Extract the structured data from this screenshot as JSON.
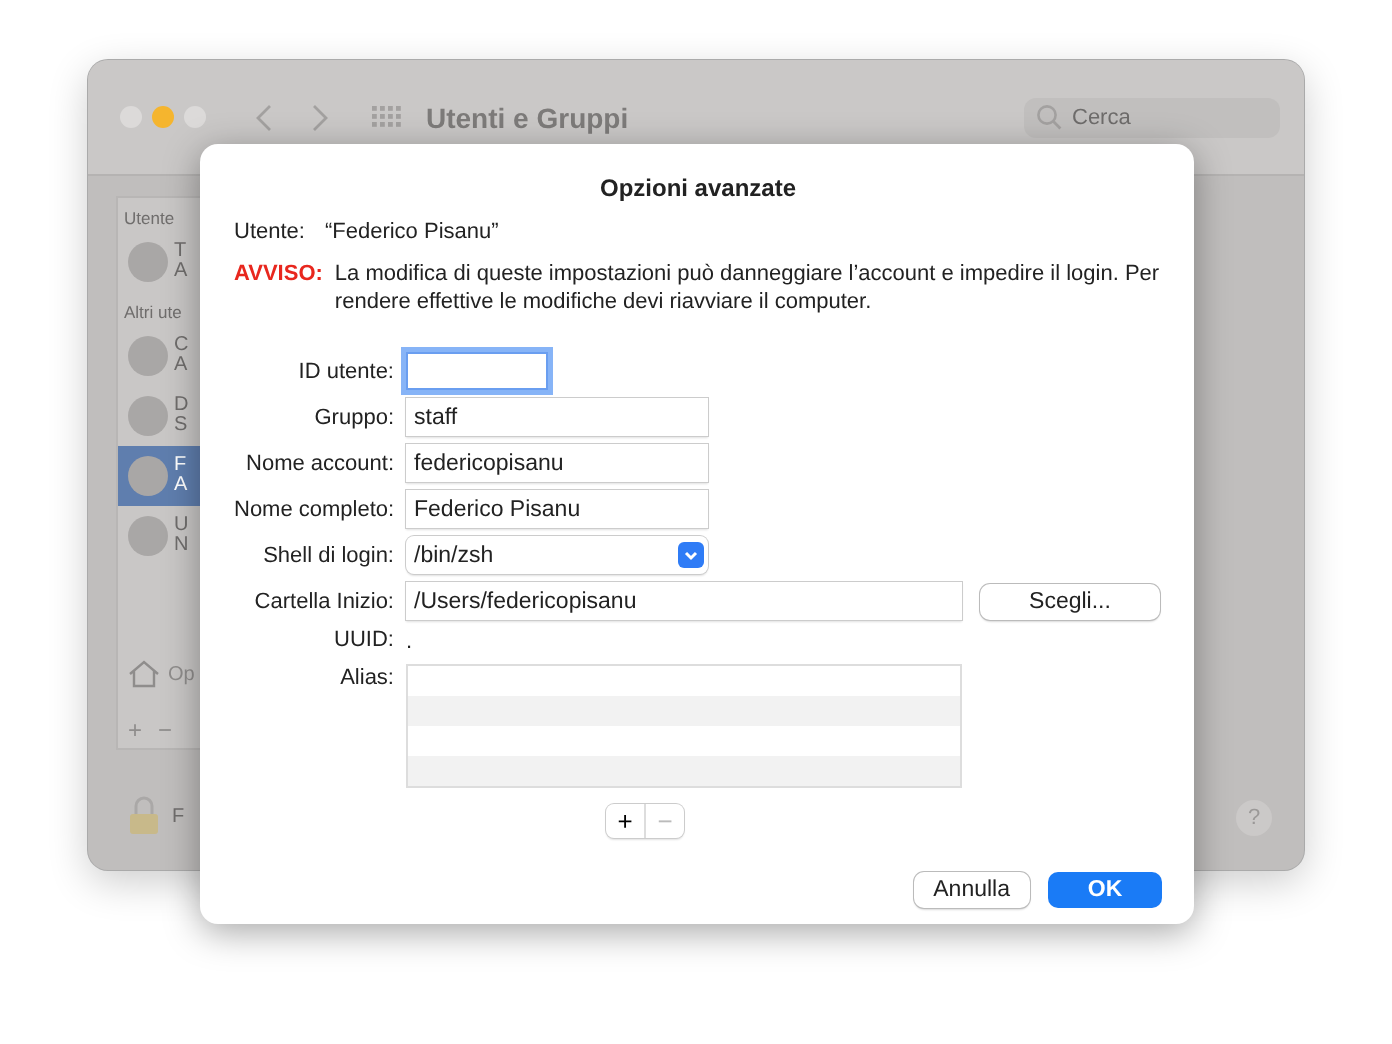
{
  "window": {
    "title": "Utenti e Gruppi",
    "search": {
      "placeholder": "Cerca"
    }
  },
  "sidebar": {
    "sections": [
      {
        "header": "Utente",
        "items": [
          {
            "initial": "T",
            "subtitle": "A",
            "selected": false
          }
        ]
      },
      {
        "header": "Altri ute",
        "items": [
          {
            "initial": "C",
            "subtitle": "A",
            "selected": false
          },
          {
            "initial": "D",
            "subtitle": "S",
            "selected": false
          },
          {
            "initial": "F",
            "subtitle": "A",
            "selected": true
          },
          {
            "initial": "U",
            "subtitle": "N",
            "selected": false
          }
        ]
      }
    ],
    "footer_item": "Op",
    "add": "+",
    "remove": "−"
  },
  "lock_label": "F",
  "help": "?",
  "sheet": {
    "title": "Opzioni avanzate",
    "user_label": "Utente:",
    "user_value": "“Federico Pisanu”",
    "warning": {
      "label": "AVVISO:",
      "text": "La modifica di queste impostazioni può danneggiare l’account e impedire il login. Per rendere effettive le modifiche devi riavviare il computer."
    },
    "fields": [
      {
        "kind": "text",
        "label": "ID utente:",
        "focused": true
      },
      {
        "kind": "text",
        "label": "Gruppo:",
        "value": "staff",
        "focused": false
      },
      {
        "kind": "text",
        "label": "Nome account:",
        "value": "federicopisanu",
        "focused": false
      },
      {
        "kind": "text",
        "label": "Nome completo:",
        "value": "Federico Pisanu",
        "focused": false
      },
      {
        "kind": "popup",
        "label": "Shell di login:",
        "value": "/bin/zsh"
      },
      {
        "kind": "path",
        "label": "Cartella Inizio:",
        "value": "/Users/federicopisanu",
        "button": "Scegli..."
      },
      {
        "kind": "static",
        "label": "UUID:",
        "value": "."
      },
      {
        "kind": "list",
        "label": "Alias:"
      }
    ],
    "add": "+",
    "remove": "−",
    "buttons": [
      {
        "label": "Annulla",
        "default": false
      },
      {
        "label": "OK",
        "default": true
      }
    ]
  }
}
